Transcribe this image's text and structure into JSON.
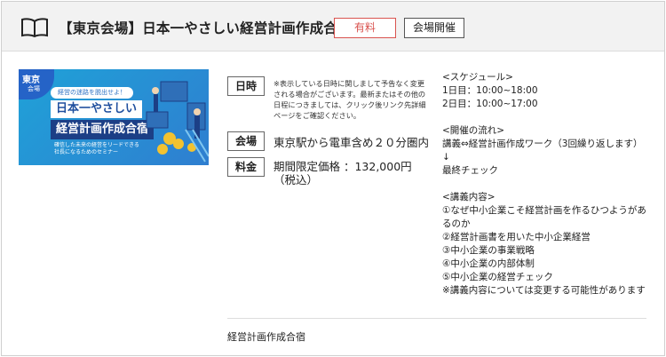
{
  "header": {
    "title": "【東京会場】日本一やさしい経営計画作成合宿",
    "badge_paid": "有料",
    "badge_venue": "会場開催"
  },
  "banner": {
    "corner_big": "東京",
    "corner_small": "会場",
    "pill": "経営の迷路を脱出せよ！",
    "line1": "日本一やさしい",
    "line2": "経営計画作成合宿",
    "sub": "確信した未来の経営をリードできる社長になるためのセミナー"
  },
  "info": {
    "date_label": "日時",
    "date_note": "※表示している日時に関しまして予告なく変更される場合がございます。最新またはその他の日程につきましては、クリック後リンク先詳細ページをご確認ください。",
    "venue_label": "会場",
    "venue_value": "東京駅から電車含め２０分圏内",
    "price_label": "料金",
    "price_value": "期間限定価格 ：132,000円（税込）"
  },
  "schedule": {
    "heading": "<スケジュール>",
    "day1": "1日目：10:00~18:00",
    "day2": "2日目：10:00~17:00",
    "flow_heading": "<開催の流れ>",
    "flow1": "講義⇔経営計画作成ワーク（3回繰り返します）",
    "arrow": "↓",
    "flow2": "最終チェック",
    "content_heading": "<講義内容>",
    "content1": "①なぜ中小企業こそ経営計画を作るひつようがあるのか",
    "content2": "②経営計画書を用いた中小企業経営",
    "content3": "③中小企業の事業戦略",
    "content4": "④中小企業の内部体制",
    "content5": "⑤中小企業の経営チェック",
    "note": "※講義内容については変更する可能性があります"
  },
  "footer": {
    "text": "経営計画作成合宿"
  },
  "colors": {
    "badge_red": "#d9534f",
    "banner_blue": "#1fa2d8",
    "banner_navy": "#1c3f86"
  },
  "icons": {
    "header_icon": "open-book-icon"
  }
}
